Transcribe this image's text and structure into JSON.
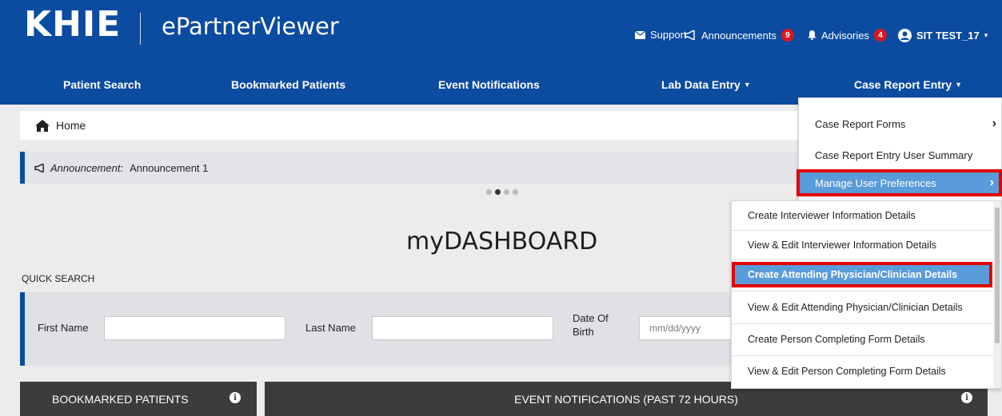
{
  "header": {
    "logo_text": "KHIE",
    "app_name": "ePartnerViewer",
    "support_label": "Support",
    "announcements_label": "Announcements",
    "announcements_count": "9",
    "advisories_label": "Advisories",
    "advisories_count": "4",
    "user_label": "SIT TEST_17"
  },
  "nav": {
    "patient_search": "Patient Search",
    "bookmarked_patients": "Bookmarked Patients",
    "event_notifications": "Event Notifications",
    "lab_data_entry": "Lab Data Entry",
    "case_report_entry": "Case Report Entry"
  },
  "breadcrumb": {
    "home": "Home"
  },
  "announcement": {
    "label": "Announcement:",
    "text": "Announcement 1"
  },
  "dashboard": {
    "title": "myDASHBOARD"
  },
  "quick_search": {
    "label": "QUICK SEARCH",
    "first_name_label": "First Name",
    "last_name_label": "Last Name",
    "dob_label_line1": "Date Of",
    "dob_label_line2": "Birth",
    "dob_placeholder": "mm/dd/yyyy"
  },
  "panels": {
    "bookmarked": "BOOKMARKED PATIENTS",
    "events": "EVENT NOTIFICATIONS (PAST 72 HOURS)"
  },
  "case_report_menu": {
    "items": [
      "Case Report Forms",
      "Case Report Entry User Summary",
      "Manage User Preferences"
    ]
  },
  "preferences_menu": {
    "items": [
      "Create Interviewer Information Details",
      "View & Edit Interviewer Information Details",
      "Create Attending Physician/Clinician Details",
      "View & Edit Attending Physician/Clinician Details",
      "Create Person Completing Form Details",
      "View & Edit Person Completing Form Details"
    ]
  },
  "colors": {
    "brand_blue": "#0b4ba0",
    "highlight_blue": "#5a9bd9",
    "callout_red": "#e30000",
    "badge_red": "#d71920"
  }
}
